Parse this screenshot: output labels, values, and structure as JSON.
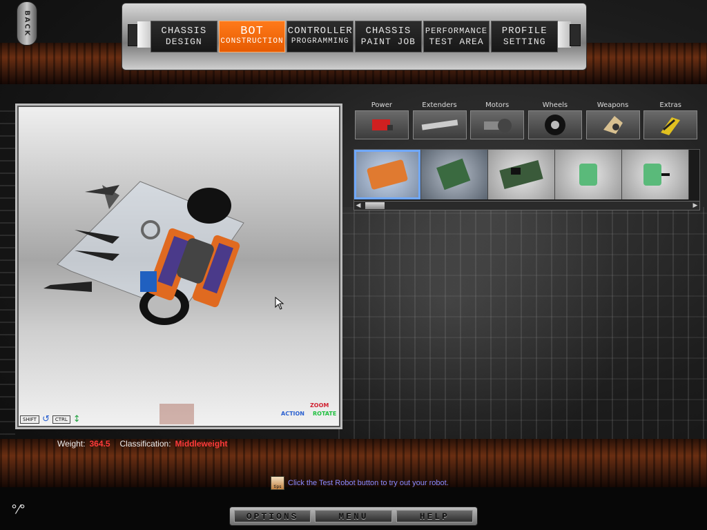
{
  "back_label": "BACK",
  "nav_tabs": [
    {
      "line1": "CHASSIS",
      "line2": "DESIGN",
      "active": false
    },
    {
      "line1": "BOT",
      "line2": "CONSTRUCTION",
      "active": true
    },
    {
      "line1": "CONTROLLER",
      "line2": "PROGRAMMING",
      "active": false
    },
    {
      "line1": "CHASSIS",
      "line2": "PAINT JOB",
      "active": false
    },
    {
      "line1": "PERFORMANCE",
      "line2": "TEST AREA",
      "active": false
    },
    {
      "line1": "PROFILE",
      "line2": "SETTING",
      "active": false
    }
  ],
  "viewport": {
    "shift_key": "SHIFT",
    "ctrl_key": "CTRL",
    "legend_zoom": "ZOOM",
    "legend_action": "ACTION",
    "legend_rotate": "ROTATE"
  },
  "part_categories": [
    {
      "label": "Power",
      "icon": "battery-icon"
    },
    {
      "label": "Extenders",
      "icon": "extender-bar-icon"
    },
    {
      "label": "Motors",
      "icon": "motor-icon"
    },
    {
      "label": "Wheels",
      "icon": "wheel-icon"
    },
    {
      "label": "Weapons",
      "icon": "weapon-icon"
    },
    {
      "label": "Extras",
      "icon": "extras-icon"
    }
  ],
  "part_items": [
    {
      "icon": "orange-speed-controller-icon",
      "state": "selected"
    },
    {
      "icon": "green-circuit-board-icon",
      "state": "dim"
    },
    {
      "icon": "circuit-board-icon",
      "state": "normal"
    },
    {
      "icon": "green-receiver-icon",
      "state": "normal"
    },
    {
      "icon": "green-receiver-antenna-icon",
      "state": "normal"
    }
  ],
  "stats": {
    "weight_label": "Weight:",
    "weight_value": "364.5",
    "class_label": "Classification:",
    "class_value": "Middleweight"
  },
  "tip": {
    "icon_text": "tips",
    "text": "Click the Test Robot button to try out your robot."
  },
  "bottom_buttons": [
    "OPTIONS",
    "MENU",
    "HELP"
  ],
  "colors": {
    "active_tab": "#ff6a00",
    "stat_value": "#ff3a3a",
    "tip_text": "#8a8aff"
  }
}
